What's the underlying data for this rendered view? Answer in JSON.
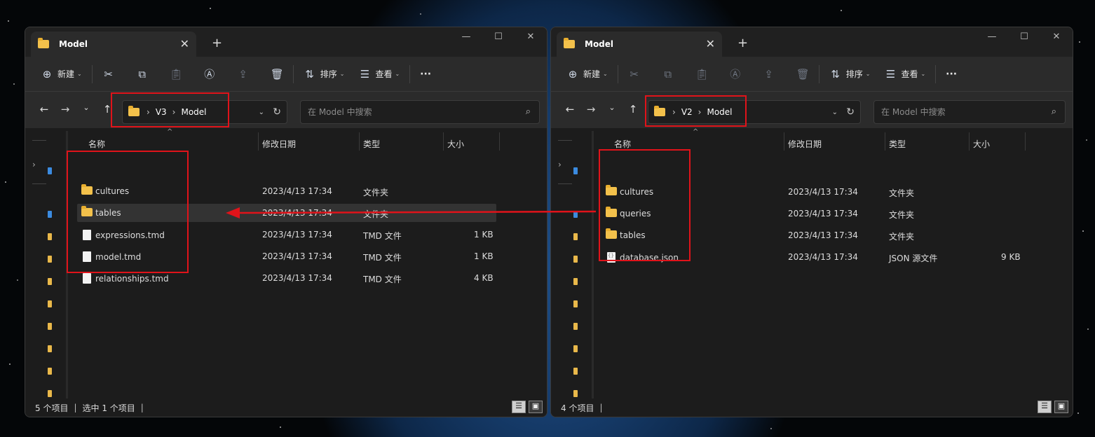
{
  "colors": {
    "highlight": "#e0131a",
    "folder": "#f3c14b",
    "window_bg": "#1c1c1c",
    "toolbar_bg": "#2b2b2b"
  },
  "window_controls": {
    "minimize": "—",
    "maximize": "☐",
    "close": "✕"
  },
  "left": {
    "tab_title": "Model",
    "toolbar": {
      "new_label": "新建",
      "sort_label": "排序",
      "view_label": "查看",
      "more_label": "···"
    },
    "breadcrumb": [
      "V3",
      "Model"
    ],
    "search_placeholder": "在 Model 中搜索",
    "columns": {
      "name": "名称",
      "modified": "修改日期",
      "type": "类型",
      "size": "大小"
    },
    "files": [
      {
        "name": "cultures",
        "modified": "2023/4/13 17:34",
        "type": "文件夹",
        "size": "",
        "kind": "folder"
      },
      {
        "name": "tables",
        "modified": "2023/4/13 17:34",
        "type": "文件夹",
        "size": "",
        "kind": "folder"
      },
      {
        "name": "expressions.tmd",
        "modified": "2023/4/13 17:34",
        "type": "TMD 文件",
        "size": "1 KB",
        "kind": "file"
      },
      {
        "name": "model.tmd",
        "modified": "2023/4/13 17:34",
        "type": "TMD 文件",
        "size": "1 KB",
        "kind": "file"
      },
      {
        "name": "relationships.tmd",
        "modified": "2023/4/13 17:34",
        "type": "TMD 文件",
        "size": "4 KB",
        "kind": "file"
      }
    ],
    "selected_index": 1,
    "status": {
      "count": "5 个项目",
      "selection": "选中 1 个项目"
    }
  },
  "right": {
    "tab_title": "Model",
    "toolbar": {
      "new_label": "新建",
      "sort_label": "排序",
      "view_label": "查看",
      "more_label": "···"
    },
    "breadcrumb": [
      "V2",
      "Model"
    ],
    "search_placeholder": "在 Model 中搜索",
    "columns": {
      "name": "名称",
      "modified": "修改日期",
      "type": "类型",
      "size": "大小"
    },
    "files": [
      {
        "name": "cultures",
        "modified": "2023/4/13 17:34",
        "type": "文件夹",
        "size": "",
        "kind": "folder"
      },
      {
        "name": "queries",
        "modified": "2023/4/13 17:34",
        "type": "文件夹",
        "size": "",
        "kind": "folder"
      },
      {
        "name": "tables",
        "modified": "2023/4/13 17:34",
        "type": "文件夹",
        "size": "",
        "kind": "folder"
      },
      {
        "name": "database.json",
        "modified": "2023/4/13 17:34",
        "type": "JSON 源文件",
        "size": "9 KB",
        "kind": "json"
      }
    ],
    "selected_index": -1,
    "status": {
      "count": "4 个项目"
    }
  }
}
